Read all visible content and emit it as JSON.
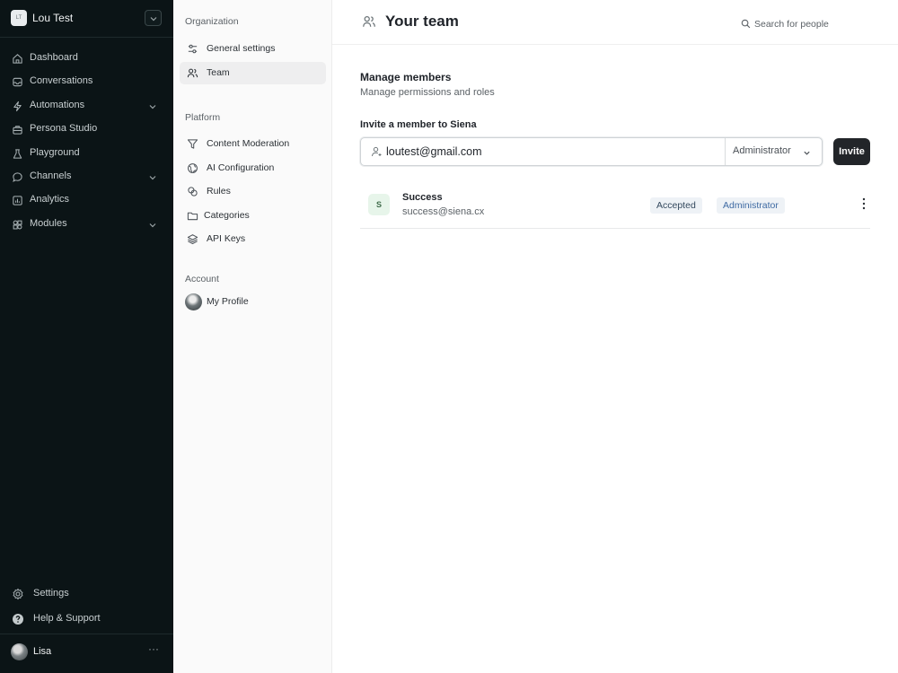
{
  "workspace": {
    "initials": "LT",
    "name": "Lou Test"
  },
  "nav": {
    "items": [
      {
        "label": "Dashboard",
        "icon": "home-icon",
        "has_children": false
      },
      {
        "label": "Conversations",
        "icon": "inbox-icon",
        "has_children": false
      },
      {
        "label": "Automations",
        "icon": "lightning-icon",
        "has_children": true
      },
      {
        "label": "Persona Studio",
        "icon": "briefcase-icon",
        "has_children": false
      },
      {
        "label": "Playground",
        "icon": "flask-icon",
        "has_children": false
      },
      {
        "label": "Channels",
        "icon": "message-icon",
        "has_children": true
      },
      {
        "label": "Analytics",
        "icon": "chart-icon",
        "has_children": false
      },
      {
        "label": "Modules",
        "icon": "modules-icon",
        "has_children": true
      }
    ],
    "settings_label": "Settings",
    "help_label": "Help & Support",
    "user_name": "Lisa"
  },
  "settings_menu": {
    "org_heading": "Organization",
    "general_label": "General settings",
    "team_label": "Team",
    "platform_heading": "Platform",
    "content_moderation_label": "Content Moderation",
    "ai_config_label": "AI Configuration",
    "rules_label": "Rules",
    "categories_label": "Categories",
    "api_keys_label": "API Keys",
    "account_heading": "Account",
    "profile_label": "My Profile"
  },
  "main": {
    "title": "Your team",
    "search_placeholder": "Search for people",
    "manage_title": "Manage members",
    "manage_subtitle": "Manage permissions and roles",
    "invite_label": "Invite a member to Siena",
    "invite_email_value": "loutest@gmail.com",
    "invite_role": "Administrator",
    "invite_button": "Invite",
    "members": [
      {
        "initial": "S",
        "name": "Success",
        "email": "success@siena.cx",
        "status": "Accepted",
        "role": "Administrator"
      }
    ]
  },
  "colors": {
    "sidebar_bg": "#0b1416",
    "invite_button_bg": "#222529",
    "role_badge_text": "#3e6aa3",
    "avatar_bg": "#e7f5ea"
  }
}
